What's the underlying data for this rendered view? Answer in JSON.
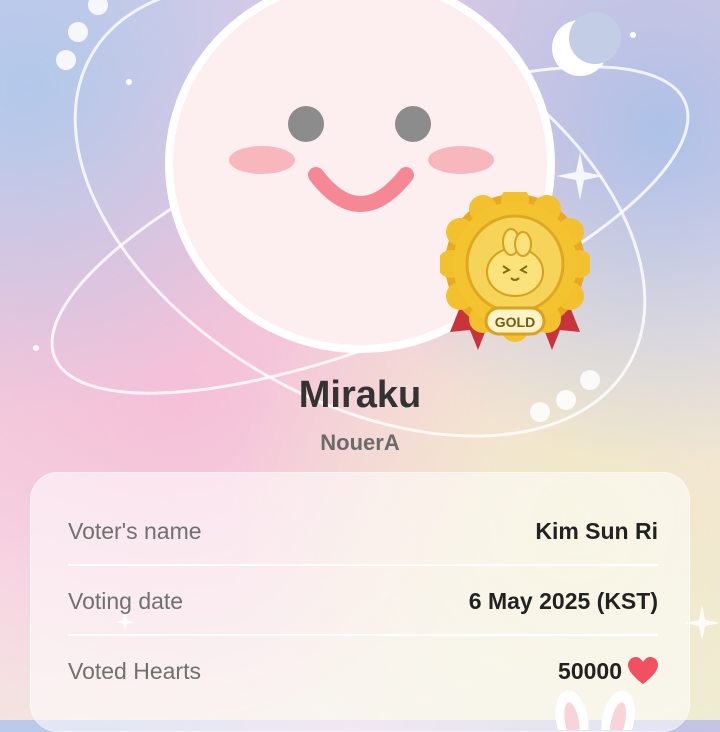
{
  "profile": {
    "name": "Miraku",
    "group": "NouerA"
  },
  "badge": {
    "label": "GOLD",
    "icon": "gold-medal-icon"
  },
  "details": {
    "voter_label": "Voter's name",
    "voter_value": "Kim Sun Ri",
    "date_label": "Voting date",
    "date_value": "6 May 2025 (KST)",
    "hearts_label": "Voted Hearts",
    "hearts_value": "50000",
    "hearts_icon": "heart-icon"
  },
  "colors": {
    "heart": "#f0505f",
    "gold": "#f3c12f",
    "ribbon": "#c9343b",
    "cheek": "#f7b7bd",
    "smile": "#f58894"
  }
}
